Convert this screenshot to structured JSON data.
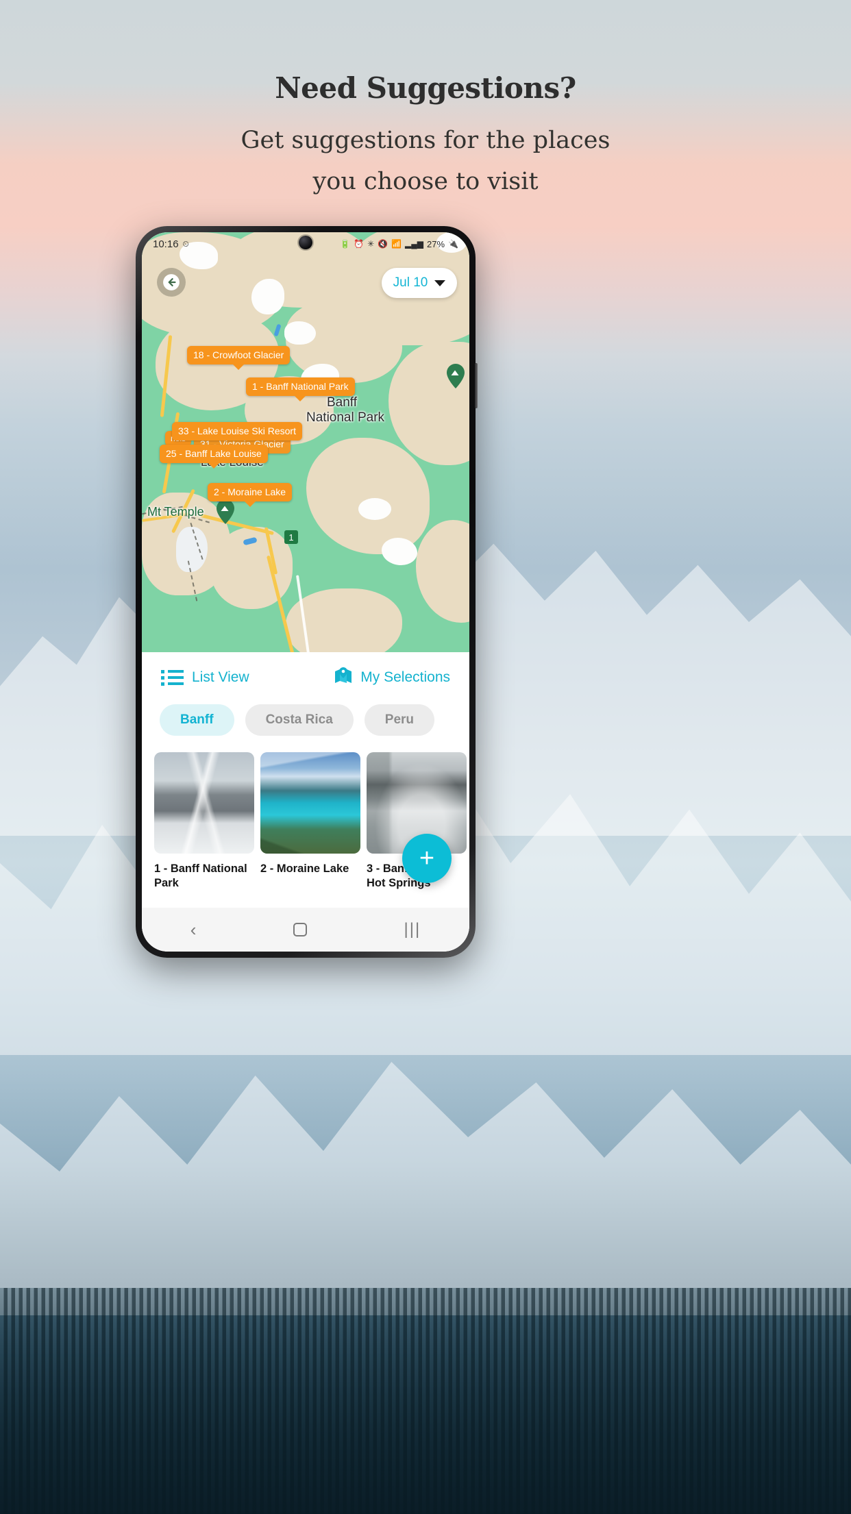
{
  "headline": {
    "title": "Need Suggestions?",
    "subtitle_line1": "Get suggestions for the places",
    "subtitle_line2": "you choose to visit"
  },
  "phone": {
    "status_bar": {
      "time": "10:16",
      "left_icon": "alarm-clock-icon",
      "right_icons": [
        "battery-saver-icon",
        "alarm-icon",
        "bluetooth-icon",
        "mute-icon",
        "wifi-icon",
        "signal-icon"
      ],
      "battery_percent": "27%",
      "battery_icon": "battery-charging-icon"
    },
    "map": {
      "back_button": "back-arrow-icon",
      "date_chip": {
        "label": "Jul 10",
        "caret": "chevron-down-icon"
      },
      "markers": [
        {
          "label": "18 - Crowfoot Glacier"
        },
        {
          "label": "1 - Banff National Park"
        },
        {
          "label": "33 - Lake Louise Ski Resort"
        },
        {
          "label": "31 - Victoria Glacier"
        },
        {
          "label": "25 - Banff Lake Louise"
        },
        {
          "label": "2 - Moraine Lake"
        },
        {
          "label": "nels"
        }
      ],
      "place_labels": [
        {
          "text": "Banff"
        },
        {
          "text": "National Park"
        },
        {
          "text": "Lake Louise"
        },
        {
          "text": "Mt Temple"
        }
      ],
      "poi_pins": [
        "mountain-pin-icon",
        "mountain-pin-icon",
        "park-marker-icon"
      ]
    },
    "sheet": {
      "view_tabs": [
        {
          "label": "List View",
          "icon": "list-icon"
        },
        {
          "label": "My Selections",
          "icon": "map-pin-icon"
        }
      ],
      "chips": [
        {
          "label": "Banff",
          "active": true
        },
        {
          "label": "Costa Rica",
          "active": false
        },
        {
          "label": "Peru",
          "active": false
        }
      ],
      "cards": [
        {
          "title": "1 - Banff National Park"
        },
        {
          "title": "2 - Moraine Lake"
        },
        {
          "title": "3 - Banff Upper Hot Springs"
        }
      ],
      "fab": {
        "icon": "plus-icon",
        "label": "+"
      }
    },
    "nav_bar": {
      "back": "back-chevron-icon",
      "home": "home-square-icon",
      "recents": "recents-bars-icon",
      "recents_glyph": "|||",
      "back_glyph": "‹"
    }
  },
  "colors": {
    "accent": "#14b2ce",
    "marker_orange": "#f7941d",
    "fab": "#0cbdd6",
    "chip_active_bg": "#ddf4f7",
    "map_green": "#7fd3a5",
    "map_sand": "#e9dcc2"
  }
}
